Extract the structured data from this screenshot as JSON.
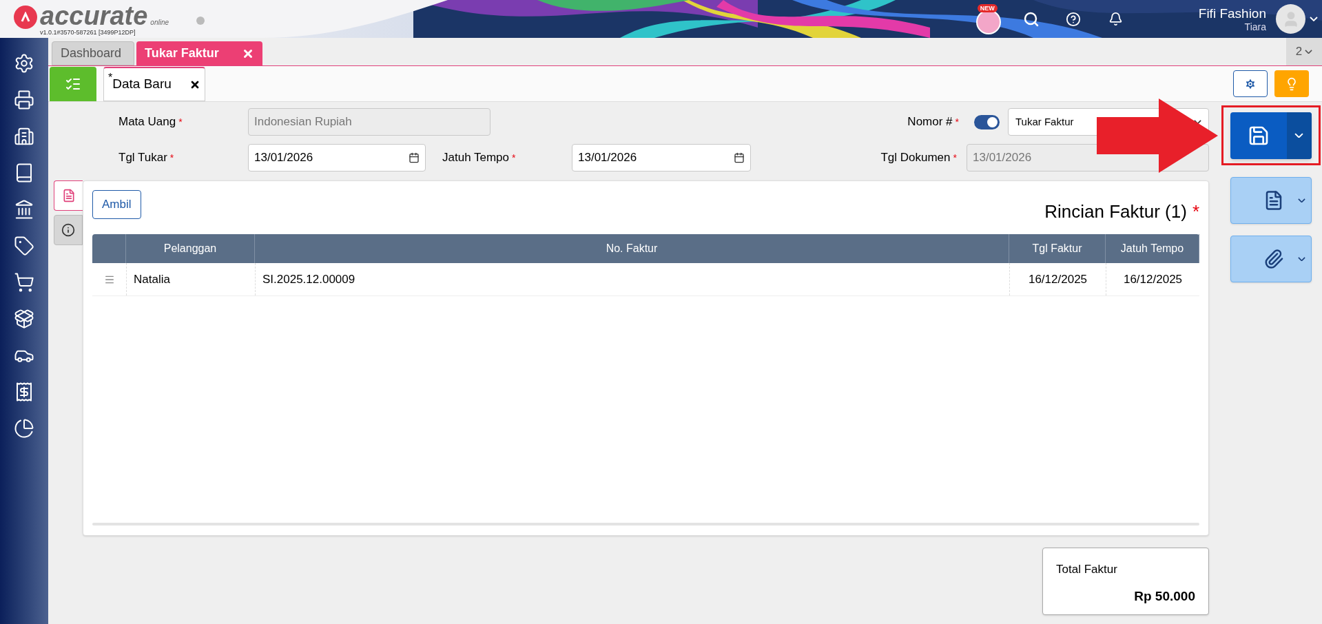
{
  "app": {
    "logo_text": "accurate",
    "logo_sub": "online",
    "version": "v1.0.1#3570-587261 [3499P12DP]"
  },
  "header": {
    "badge": "NEW",
    "company": "Fifi Fashion",
    "user": "Tiara"
  },
  "tabs": [
    {
      "label": "Dashboard",
      "selected": false
    },
    {
      "label": "Tukar Faktur",
      "selected": true
    }
  ],
  "tab_count": "2",
  "subtabs": [
    {
      "label": "Data Baru",
      "mark": "*",
      "selected": true
    }
  ],
  "form": {
    "mata_uang": {
      "label": "Mata Uang",
      "mark": "*",
      "value": "Indonesian Rupiah",
      "disabled": true
    },
    "tgl_tukar": {
      "label": "Tgl Tukar",
      "mark": "*",
      "value": "13/01/2026",
      "disabled": false
    },
    "jatuh_tempo": {
      "label": "Jatuh Tempo",
      "mark": "*",
      "value": "13/01/2026",
      "disabled": false
    },
    "nomor": {
      "label": "Nomor #",
      "mark": "*",
      "on": true,
      "value": "Tukar Faktur"
    },
    "tgl_dokumen": {
      "label": "Tgl Dokumen",
      "mark": "*",
      "value": "13/01/2026",
      "disabled": true
    }
  },
  "side_tabs": [
    {
      "selected": true
    },
    {
      "selected": false
    }
  ],
  "details": {
    "button": "Ambil",
    "title": "Rincian Faktur (1)",
    "mark": "*",
    "columns": [
      "Pelanggan",
      "No. Faktur",
      "Tgl Faktur",
      "Jatuh Tempo"
    ],
    "rows": [
      {
        "cells": [
          "Natalia",
          "SI.2025.12.00009",
          "16/12/2025",
          "16/12/2025"
        ]
      }
    ]
  },
  "total": {
    "label": "Total Faktur",
    "value": "Rp 50.000"
  }
}
